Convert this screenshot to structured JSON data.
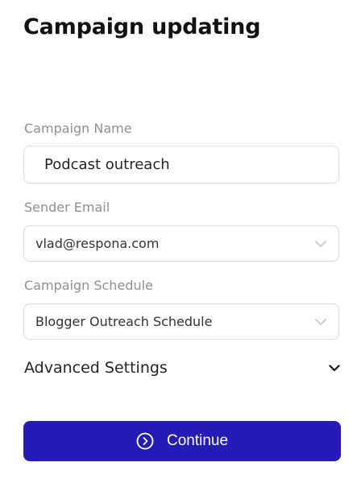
{
  "title": "Campaign updating",
  "campaign_name": {
    "label": "Campaign Name",
    "value": "Podcast outreach"
  },
  "sender_email": {
    "label": "Sender Email",
    "value": "vlad@respona.com",
    "icon": "chevron-down-icon"
  },
  "campaign_schedule": {
    "label": "Campaign Schedule",
    "value": "Blogger Outreach Schedule",
    "icon": "chevron-down-icon"
  },
  "advanced_settings": {
    "label": "Advanced Settings",
    "icon": "chevron-down-icon"
  },
  "continue_button": {
    "label": "Continue",
    "icon": "circle-chevron-right-icon",
    "color": "#251cb7"
  }
}
